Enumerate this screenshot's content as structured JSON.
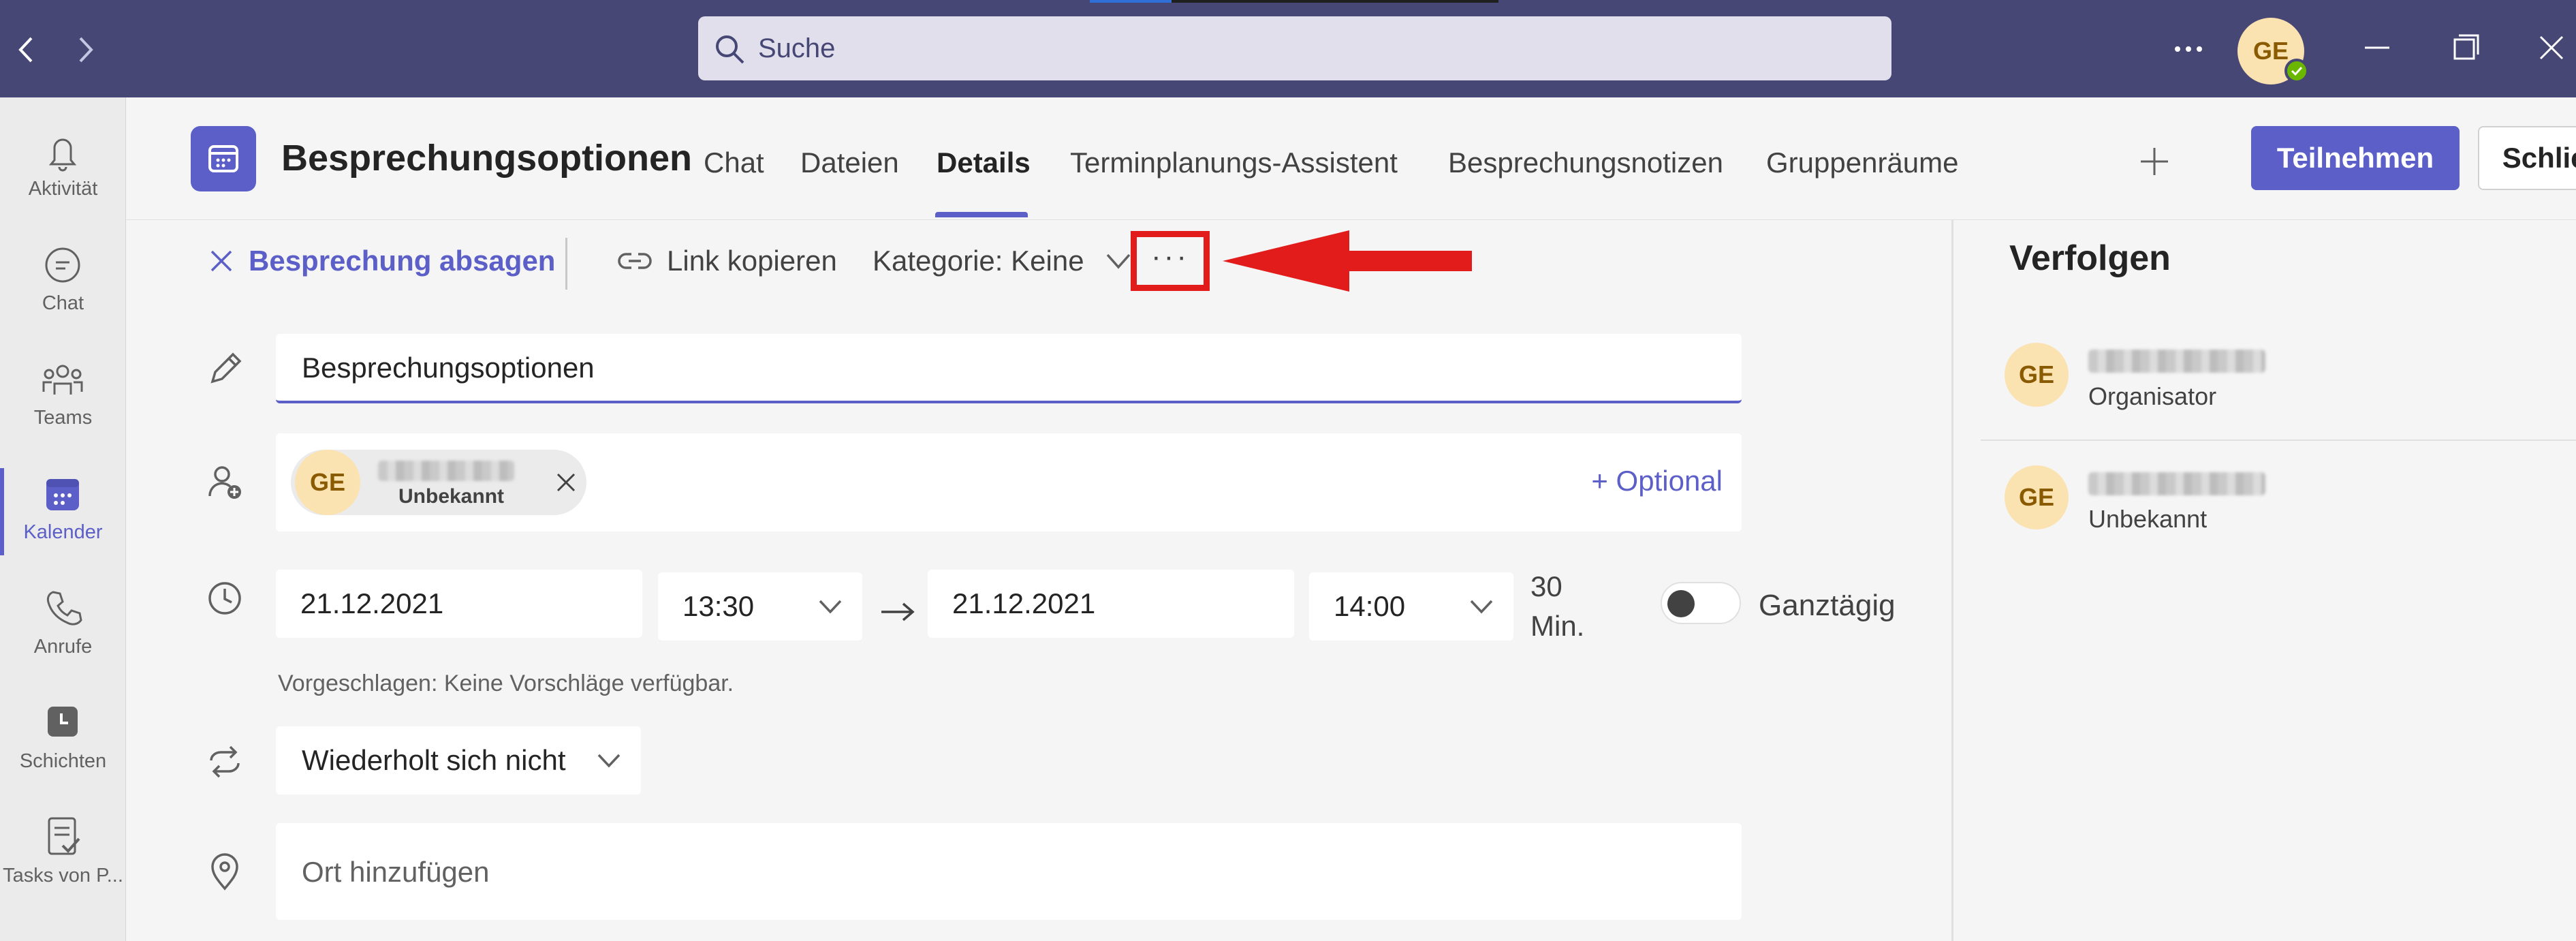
{
  "titlebar": {
    "search_placeholder": "Suche",
    "more_label": "···",
    "user_initials": "GE",
    "colors": {
      "bar": "#464775",
      "presence": "#6bb700"
    }
  },
  "rail": {
    "items": [
      {
        "label": "Aktivität",
        "icon": "bell-icon"
      },
      {
        "label": "Chat",
        "icon": "chat-icon"
      },
      {
        "label": "Teams",
        "icon": "teams-icon"
      },
      {
        "label": "Kalender",
        "icon": "calendar-icon",
        "active": true
      },
      {
        "label": "Anrufe",
        "icon": "phone-icon"
      },
      {
        "label": "Schichten",
        "icon": "shifts-icon"
      },
      {
        "label": "Tasks von P...",
        "icon": "tasks-icon"
      }
    ]
  },
  "header": {
    "title": "Besprechungsoptionen",
    "tabs": [
      {
        "label": "Chat"
      },
      {
        "label": "Dateien"
      },
      {
        "label": "Details",
        "active": true
      },
      {
        "label": "Terminplanungs-Assistent"
      },
      {
        "label": "Besprechungsnotizen"
      },
      {
        "label": "Gruppenräume"
      }
    ],
    "join_label": "Teilnehmen",
    "close_label": "Schließen",
    "accent": "#5b5fc7"
  },
  "toolbar": {
    "cancel_label": "Besprechung absagen",
    "copy_link_label": "Link kopieren",
    "category_label": "Kategorie: Keine",
    "more_label": "···"
  },
  "form": {
    "title_value": "Besprechungsoptionen",
    "attendee": {
      "initials": "GE",
      "status": "Unbekannt"
    },
    "optional_label": "+ Optional",
    "start_date": "21.12.2021",
    "start_time": "13:30",
    "end_date": "21.12.2021",
    "end_time": "14:00",
    "duration_value": "30",
    "duration_unit": "Min.",
    "allday_label": "Ganztägig",
    "allday_on": false,
    "suggestion": "Vorgeschlagen: Keine Vorschläge verfügbar.",
    "repeat_value": "Wiederholt sich nicht",
    "location_placeholder": "Ort hinzufügen"
  },
  "tracking": {
    "title": "Verfolgen",
    "attendees": [
      {
        "initials": "GE",
        "role": "Organisator"
      },
      {
        "initials": "GE",
        "role": "Unbekannt"
      }
    ]
  }
}
